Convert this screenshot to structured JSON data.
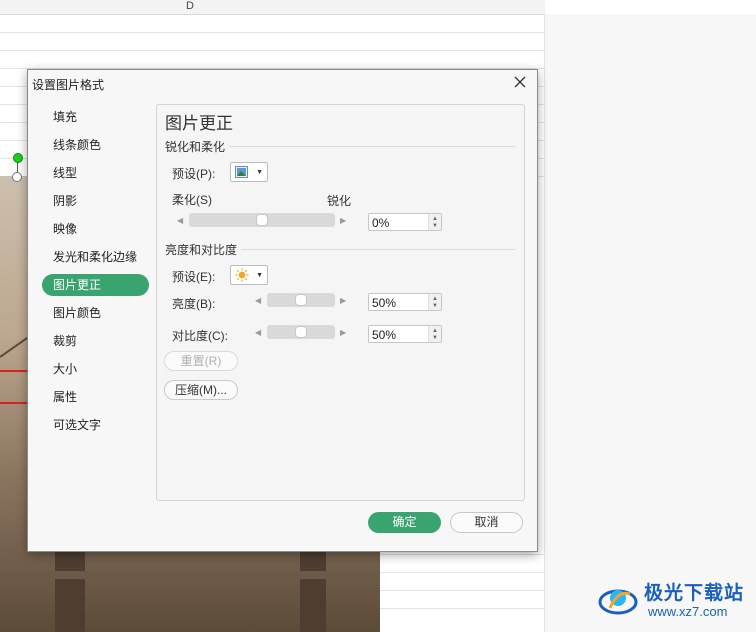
{
  "sheet": {
    "column_label": "D"
  },
  "dialog": {
    "title": "设置图片格式",
    "nav": [
      {
        "label": "填充"
      },
      {
        "label": "线条颜色"
      },
      {
        "label": "线型"
      },
      {
        "label": "阴影"
      },
      {
        "label": "映像"
      },
      {
        "label": "发光和柔化边缘"
      },
      {
        "label": "图片更正",
        "active": true
      },
      {
        "label": "图片颜色"
      },
      {
        "label": "裁剪"
      },
      {
        "label": "大小"
      },
      {
        "label": "属性"
      },
      {
        "label": "可选文字"
      }
    ],
    "panel": {
      "title": "图片更正",
      "sharpen": {
        "section_title": "锐化和柔化",
        "preset_label": "预设(P):",
        "soften_label": "柔化(S)",
        "sharpen_label": "锐化",
        "value": "0%",
        "level": 0.5
      },
      "brightness_contrast": {
        "section_title": "亮度和对比度",
        "preset_label": "预设(E):",
        "brightness_label": "亮度(B):",
        "brightness_value": "50%",
        "brightness_level": 0.5,
        "contrast_label": "对比度(C):",
        "contrast_value": "50%",
        "contrast_level": 0.5
      },
      "reset_label": "重置(R)",
      "compress_label": "压缩(M)..."
    },
    "ok_label": "确定",
    "cancel_label": "取消"
  },
  "watermark": {
    "text": "极光下载站",
    "url": "www.xz7.com"
  },
  "colors": {
    "accent": "#3aa471",
    "highlight_box": "#e02020"
  }
}
